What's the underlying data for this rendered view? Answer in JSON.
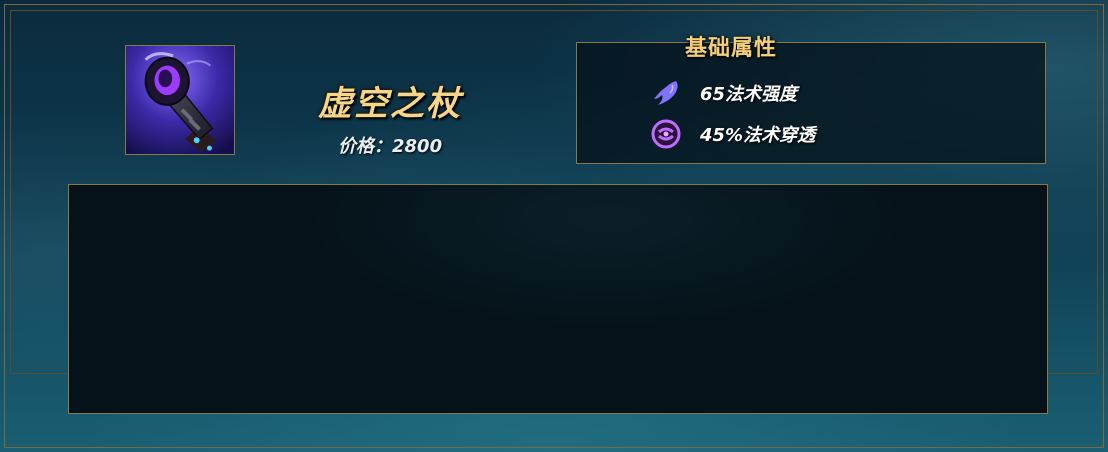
{
  "item": {
    "name": "虚空之杖",
    "price_label": "价格：",
    "price_value": "2800",
    "icon": "void-staff-icon"
  },
  "stats": {
    "title": "基础属性",
    "rows": [
      {
        "icon": "ability-power-icon",
        "text": "65法术强度",
        "color": "#7f73ff"
      },
      {
        "icon": "magic-penetration-icon",
        "text": "45%法术穿透",
        "color": "#c06cff"
      }
    ]
  },
  "description": {
    "text": ""
  },
  "colors": {
    "gold_text": "#f6d78a",
    "gold_border": "#8a7845",
    "panel_bg": "#051219"
  }
}
